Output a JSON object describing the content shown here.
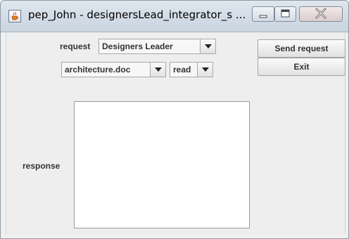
{
  "window": {
    "title": "pep_John - designersLead_integrator_s ..."
  },
  "form": {
    "request_label": "request",
    "request_value": "Designers Leader",
    "document_value": "architecture.doc",
    "operation_value": "read",
    "response_label": "response",
    "response_text": ""
  },
  "buttons": {
    "send": "Send request",
    "exit": "Exit"
  },
  "icons": {
    "app": "java-cup-icon",
    "minimize": "minimize-icon",
    "maximize": "maximize-icon",
    "close": "close-icon",
    "dropdown": "chevron-down-icon"
  }
}
